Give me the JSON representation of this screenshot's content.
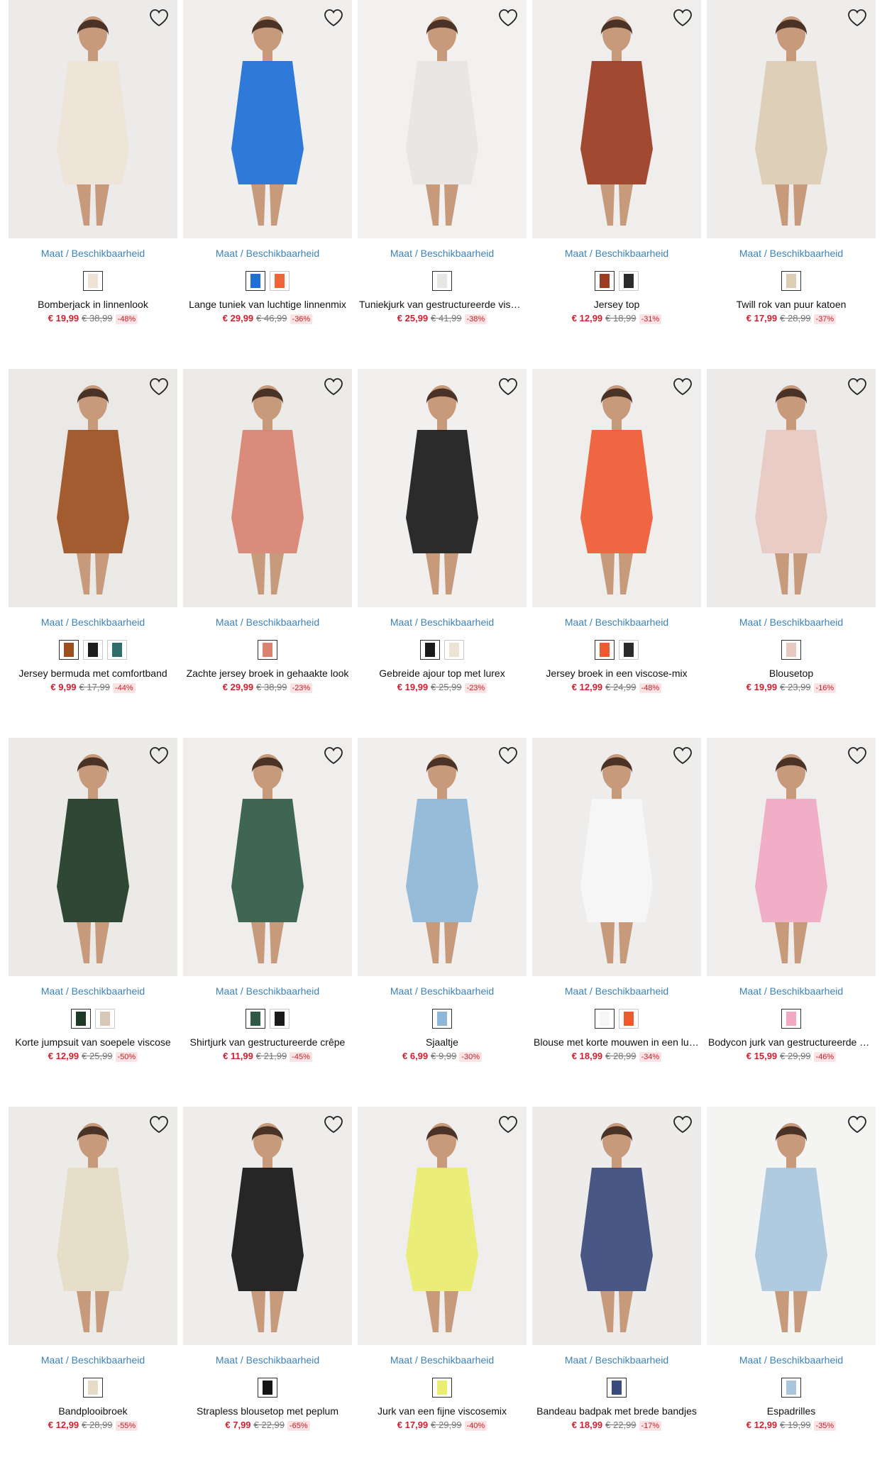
{
  "size_link_label": "Maat / Beschikbaarheid",
  "products": [
    {
      "name": "Bomberjack in linnenlook",
      "price": "€ 19,99",
      "old_price": "€ 38,99",
      "discount": "-48%",
      "bg": "#ecebea",
      "colors": [
        "#efe3d6"
      ]
    },
    {
      "name": "Lange tuniek van luchtige linnenmix",
      "price": "€ 29,99",
      "old_price": "€ 46,99",
      "discount": "-36%",
      "bg": "#f0efed",
      "colors": [
        "#1e6fd6",
        "#f0663a"
      ]
    },
    {
      "name": "Tuniekjurk van gestructureerde viscose",
      "price": "€ 25,99",
      "old_price": "€ 41,99",
      "discount": "-38%",
      "bg": "#f2f1ef",
      "colors": [
        "#e8e6e2"
      ]
    },
    {
      "name": "Jersey top",
      "price": "€ 12,99",
      "old_price": "€ 18,99",
      "discount": "-31%",
      "bg": "#efeeec",
      "colors": [
        "#9b3b22",
        "#2b2b2b"
      ]
    },
    {
      "name": "Twill rok van puur katoen",
      "price": "€ 17,99",
      "old_price": "€ 28,99",
      "discount": "-37%",
      "bg": "#eeedeb",
      "colors": [
        "#dccdb3"
      ]
    },
    {
      "name": "Jersey bermuda met comfortband",
      "price": "€ 9,99",
      "old_price": "€ 17,99",
      "discount": "-44%",
      "bg": "#ebe9e6",
      "colors": [
        "#9c4f1f",
        "#1d1d1d",
        "#2f6e6c"
      ]
    },
    {
      "name": "Zachte jersey broek in gehaakte look",
      "price": "€ 29,99",
      "old_price": "€ 38,99",
      "discount": "-23%",
      "bg": "#ecebe8",
      "colors": [
        "#d98272"
      ]
    },
    {
      "name": "Gebreide ajour top met lurex",
      "price": "€ 19,99",
      "old_price": "€ 25,99",
      "discount": "-23%",
      "bg": "#f1f0ee",
      "colors": [
        "#1a1a1a",
        "#ece3d4"
      ]
    },
    {
      "name": "Jersey broek in een viscose-mix",
      "price": "€ 12,99",
      "old_price": "€ 24,99",
      "discount": "-48%",
      "bg": "#efeeec",
      "colors": [
        "#ef5a33",
        "#2a2a2a"
      ]
    },
    {
      "name": "Blousetop",
      "price": "€ 19,99",
      "old_price": "€ 23,99",
      "discount": "-16%",
      "bg": "#ecebe9",
      "colors": [
        "#e8c9c2"
      ]
    },
    {
      "name": "Korte jumpsuit van soepele viscose",
      "price": "€ 12,99",
      "old_price": "€ 25,99",
      "discount": "-50%",
      "bg": "#ebeae7",
      "colors": [
        "#1e3a26",
        "#d8c8b8"
      ]
    },
    {
      "name": "Shirtjurk van gestructureerde crêpe",
      "price": "€ 11,99",
      "old_price": "€ 21,99",
      "discount": "-45%",
      "bg": "#efeeec",
      "colors": [
        "#2f5a45",
        "#1a1a1a"
      ]
    },
    {
      "name": "Sjaaltje",
      "price": "€ 6,99",
      "old_price": "€ 9,99",
      "discount": "-30%",
      "bg": "#f0efed",
      "colors": [
        "#8fb7d8"
      ]
    },
    {
      "name": "Blouse met korte mouwen in een luchtige kwaliteit",
      "price": "€ 18,99",
      "old_price": "€ 28,99",
      "discount": "-34%",
      "bg": "#eeedeb",
      "colors": [
        "#f6f6f6",
        "#ee5a2c"
      ]
    },
    {
      "name": "Bodycon jurk van gestructureerde crêpe",
      "price": "€ 15,99",
      "old_price": "€ 29,99",
      "discount": "-46%",
      "bg": "#efeeed",
      "colors": [
        "#f1a9c3"
      ]
    },
    {
      "name": "Bandplooibroek",
      "price": "€ 12,99",
      "old_price": "€ 28,99",
      "discount": "-55%",
      "bg": "#ecebe8",
      "colors": [
        "#e6dcc6"
      ]
    },
    {
      "name": "Strapless blousetop met peplum",
      "price": "€ 7,99",
      "old_price": "€ 22,99",
      "discount": "-65%",
      "bg": "#eeedeb",
      "colors": [
        "#151515"
      ]
    },
    {
      "name": "Jurk van een fijne viscosemix",
      "price": "€ 17,99",
      "old_price": "€ 29,99",
      "discount": "-40%",
      "bg": "#efeeec",
      "colors": [
        "#e9ee6e"
      ]
    },
    {
      "name": "Bandeau badpak met brede bandjes",
      "price": "€ 18,99",
      "old_price": "€ 22,99",
      "discount": "-17%",
      "bg": "#edecea",
      "colors": [
        "#3a4a7a"
      ]
    },
    {
      "name": "Espadrilles",
      "price": "€ 12,99",
      "old_price": "€ 19,99",
      "discount": "-35%",
      "bg": "#f4f4f3",
      "colors": [
        "#a9c6de"
      ]
    }
  ]
}
